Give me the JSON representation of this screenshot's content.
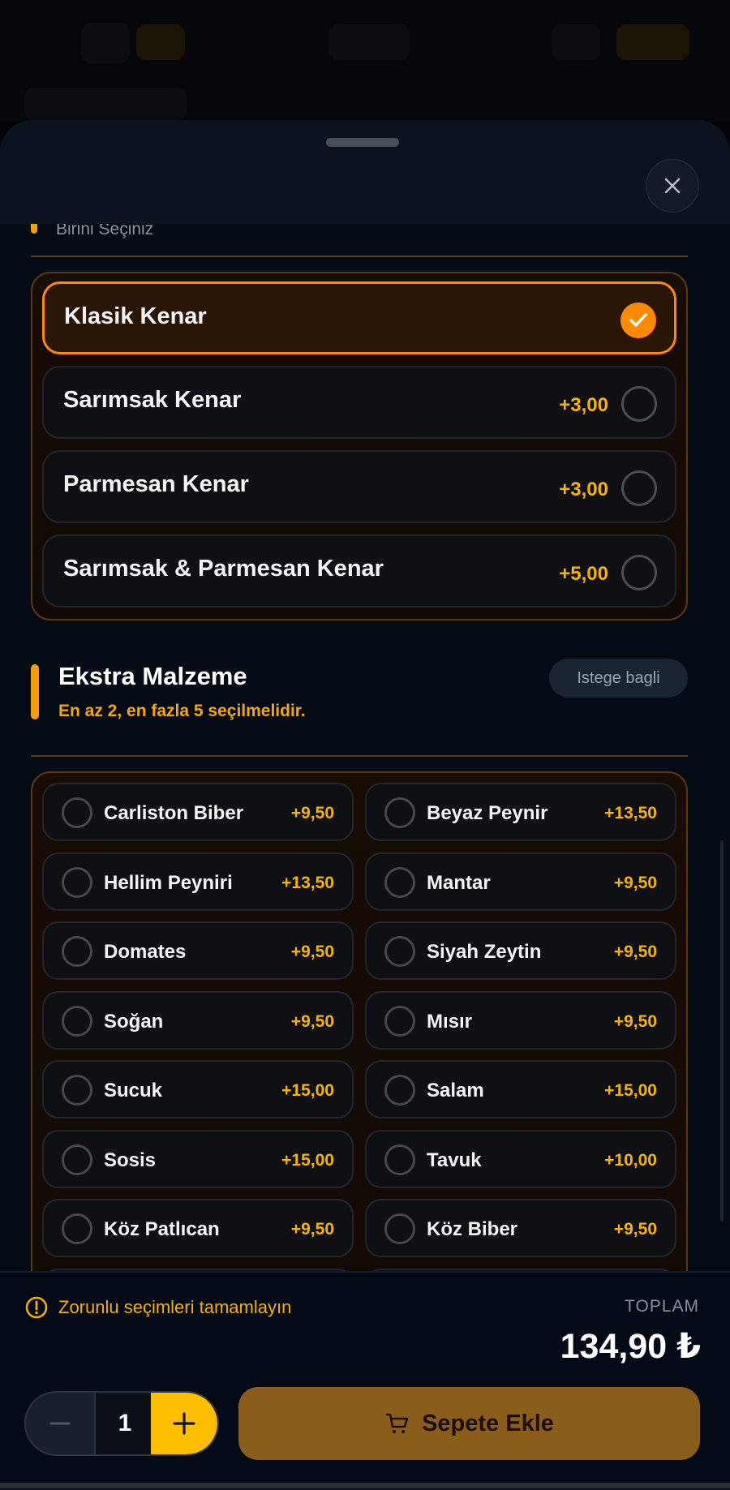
{
  "crust_group": {
    "hint": "Birini Seçiniz",
    "options": [
      {
        "label": "Klasik Kenar",
        "price": "",
        "selected": true
      },
      {
        "label": "Sarımsak Kenar",
        "price": "+3,00",
        "selected": false
      },
      {
        "label": "Parmesan Kenar",
        "price": "+3,00",
        "selected": false
      },
      {
        "label": "Sarımsak & Parmesan Kenar",
        "price": "+5,00",
        "selected": false
      }
    ]
  },
  "extras": {
    "title": "Ekstra Malzeme",
    "subtitle": "En az 2, en fazla 5 seçilmelidir.",
    "badge": "Istege bagli",
    "items": [
      {
        "label": "Carliston Biber",
        "price": "+9,50"
      },
      {
        "label": "Beyaz Peynir",
        "price": "+13,50"
      },
      {
        "label": "Hellim Peyniri",
        "price": "+13,50"
      },
      {
        "label": "Mantar",
        "price": "+9,50"
      },
      {
        "label": "Domates",
        "price": "+9,50"
      },
      {
        "label": "Siyah Zeytin",
        "price": "+9,50"
      },
      {
        "label": "Soğan",
        "price": "+9,50"
      },
      {
        "label": "Mısır",
        "price": "+9,50"
      },
      {
        "label": "Sucuk",
        "price": "+15,00"
      },
      {
        "label": "Salam",
        "price": "+15,00"
      },
      {
        "label": "Sosis",
        "price": "+15,00"
      },
      {
        "label": "Tavuk",
        "price": "+10,00"
      },
      {
        "label": "Köz Patlıcan",
        "price": "+9,50"
      },
      {
        "label": "Köz Biber",
        "price": "+9,50"
      }
    ]
  },
  "footer": {
    "warning": "Zorunlu seçimleri tamamlayın",
    "total_label": "TOPLAM",
    "total_value": "134,90 ₺",
    "quantity": "1",
    "add_to_cart": "Sepete Ekle"
  },
  "colors": {
    "accent": "#f5a000",
    "selected_border": "#ff8a00",
    "price": "#f5b400",
    "add_button": "#8a5d1a"
  },
  "icons": [
    "close-icon",
    "check-icon",
    "warning-icon",
    "minus-icon",
    "plus-icon",
    "cart-icon"
  ]
}
